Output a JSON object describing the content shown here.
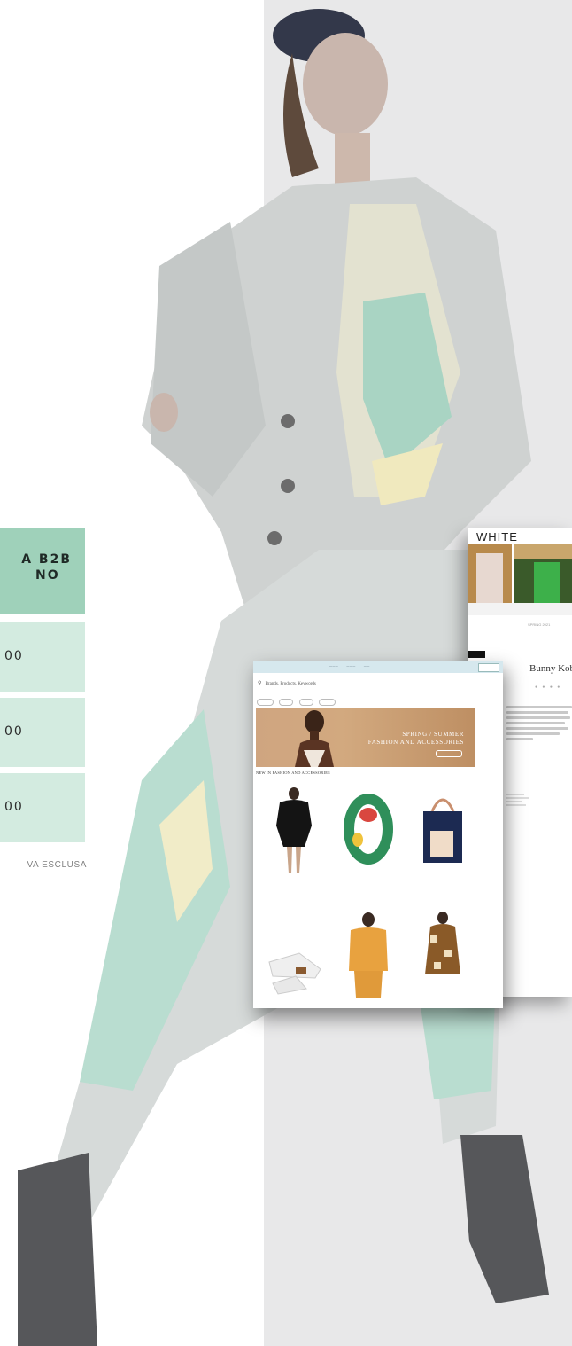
{
  "colors": {
    "panel_bg": "#e8e8e9",
    "mint_dark": "#9fd1ba",
    "mint_light": "#d3ebe0",
    "hero_tan": "#cfa580",
    "topbar": "#d6e8ee"
  },
  "left_cards": {
    "title_line1": "A B2B",
    "title_line2": "NO",
    "values": [
      "00",
      "00",
      "00"
    ],
    "note": "VA ESCLUSA"
  },
  "brand_screen": {
    "brand": "WHITE",
    "shop_label": "SPRING 2021",
    "designer_name": "Bunny Kobo",
    "stats": [
      "",
      ""
    ]
  },
  "market_screen": {
    "search_text": "Brands, Products, Keywords",
    "hero_line1": "SPRING / SUMMER",
    "hero_line2": "FASHION AND ACCESSORIES",
    "section_label": "NEW IN FASHION AND ACCESSORIES"
  },
  "icons": [
    "search-icon",
    "cart-icon",
    "instagram-icon",
    "facebook-icon"
  ]
}
